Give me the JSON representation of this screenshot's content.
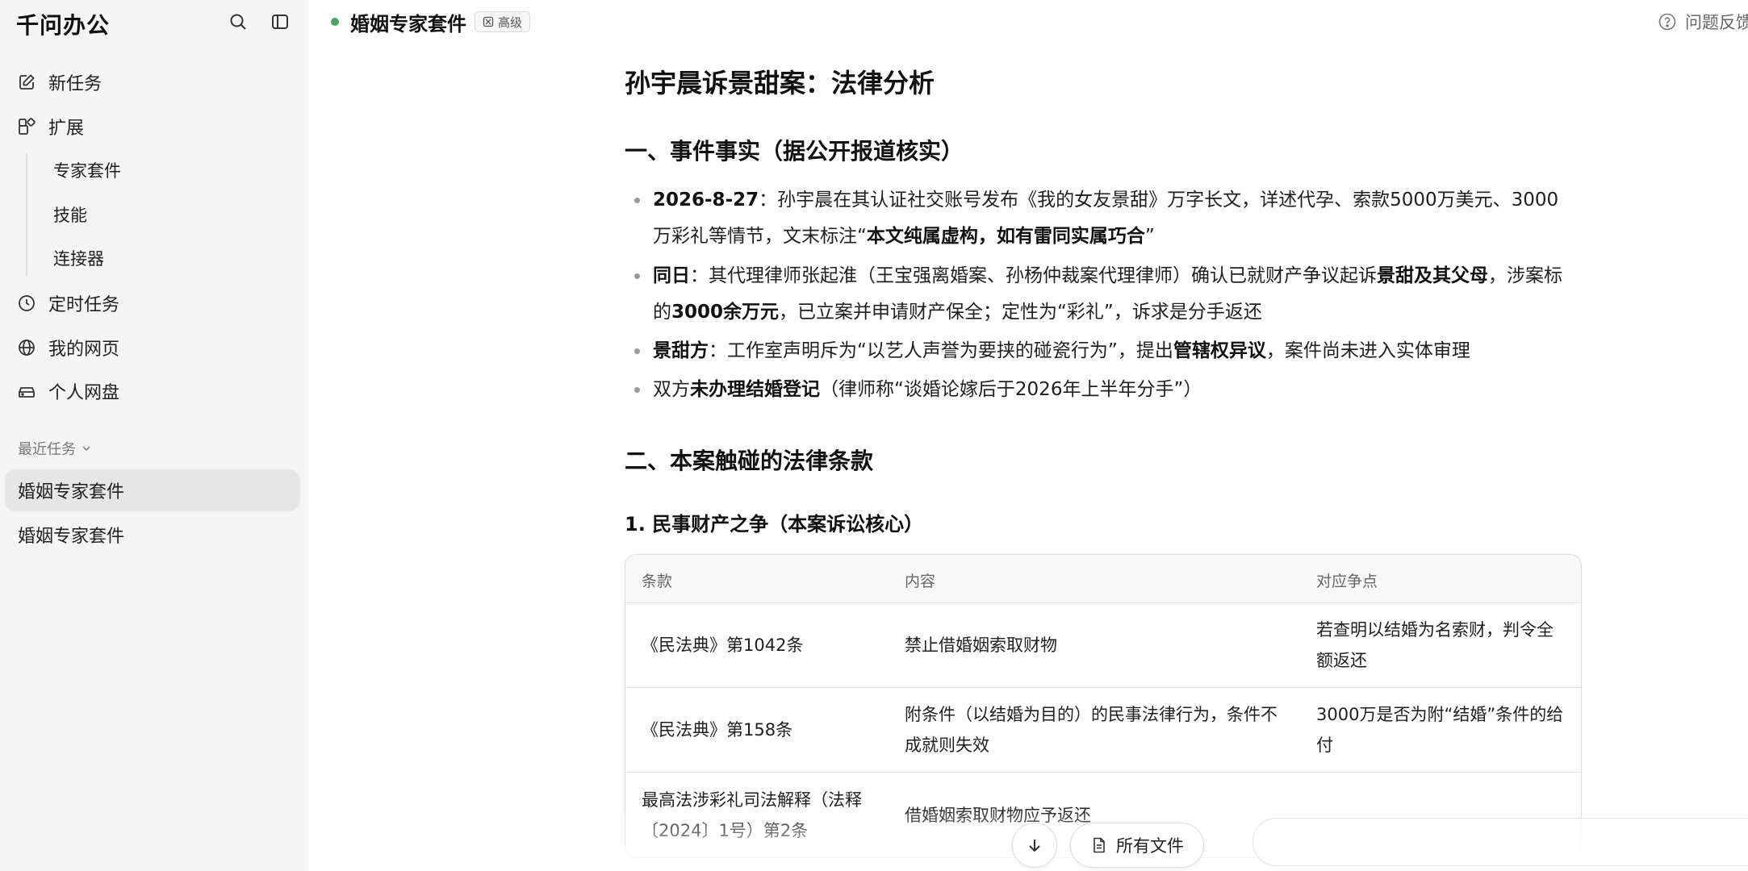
{
  "app": {
    "name": "千问办公"
  },
  "sidebar": {
    "top_icons": [
      "search-icon",
      "sidebar-toggle-icon"
    ],
    "items": [
      {
        "label": "新任务",
        "icon": "edit-icon"
      },
      {
        "label": "扩展",
        "icon": "extensions-icon"
      }
    ],
    "sub_items": [
      {
        "label": "专家套件"
      },
      {
        "label": "技能"
      },
      {
        "label": "连接器"
      }
    ],
    "items_after": [
      {
        "label": "定时任务",
        "icon": "clock-icon"
      },
      {
        "label": "我的网页",
        "icon": "globe-icon"
      },
      {
        "label": "个人网盘",
        "icon": "drive-icon"
      }
    ],
    "recent": {
      "header": "最近任务",
      "items": [
        {
          "label": "婚姻专家套件",
          "active": true
        },
        {
          "label": "婚姻专家套件",
          "active": false
        }
      ]
    }
  },
  "header": {
    "status_color": "#45a561",
    "title": "婚姻专家套件",
    "badge": "高级",
    "feedback": "问题反馈"
  },
  "document": {
    "title": "孙宇晨诉景甜案：法律分析",
    "section1": {
      "heading": "一、事件事实（据公开报道核实）",
      "bullets": [
        [
          {
            "t": "2026-8-27",
            "b": true
          },
          {
            "t": "：孙宇晨在其认证社交账号发布《我的女友景甜》万字长文，详述代孕、索款5000万美元、3000万彩礼等情节，文末标注“",
            "b": false
          },
          {
            "t": "本文纯属虚构，如有雷同实属巧合",
            "b": true
          },
          {
            "t": "”",
            "b": false
          }
        ],
        [
          {
            "t": "同日",
            "b": true
          },
          {
            "t": "：其代理律师张起淮（王宝强离婚案、孙杨仲裁案代理律师）确认已就财产争议起诉",
            "b": false
          },
          {
            "t": "景甜及其父母",
            "b": true
          },
          {
            "t": "，涉案标的",
            "b": false
          },
          {
            "t": "3000余万元",
            "b": true
          },
          {
            "t": "，已立案并申请财产保全；定性为“彩礼”，诉求是分手返还",
            "b": false
          }
        ],
        [
          {
            "t": "景甜方",
            "b": true
          },
          {
            "t": "：工作室声明斥为“以艺人声誉为要挟的碰瓷行为”，提出",
            "b": false
          },
          {
            "t": "管辖权异议",
            "b": true
          },
          {
            "t": "，案件尚未进入实体审理",
            "b": false
          }
        ],
        [
          {
            "t": "双方",
            "b": false
          },
          {
            "t": "未办理结婚登记",
            "b": true
          },
          {
            "t": "（律师称“谈婚论嫁后于2026年上半年分手”）",
            "b": false
          }
        ]
      ]
    },
    "section2": {
      "heading": "二、本案触碰的法律条款",
      "sub1": {
        "heading": "1. 民事财产之争（本案诉讼核心）",
        "table": {
          "columns": [
            "条款",
            "内容",
            "对应争点"
          ],
          "rows": [
            [
              "《民法典》第1042条",
              "禁止借婚姻索取财物",
              "若查明以结婚为名索财，判令全额返还"
            ],
            [
              "《民法典》第158条",
              "附条件（以结婚为目的）的民事法律行为，条件不成就则失效",
              "3000万是否为附“结婚”条件的给付"
            ],
            [
              "最高法涉彩礼司法解释（法释〔2024〕1号）第2条",
              "借婚姻索取财物应予返还",
              ""
            ]
          ]
        }
      }
    }
  },
  "bottom": {
    "scroll_down_icon": "arrow-down-icon",
    "files_button": "所有文件",
    "files_icon": "file-icon"
  }
}
